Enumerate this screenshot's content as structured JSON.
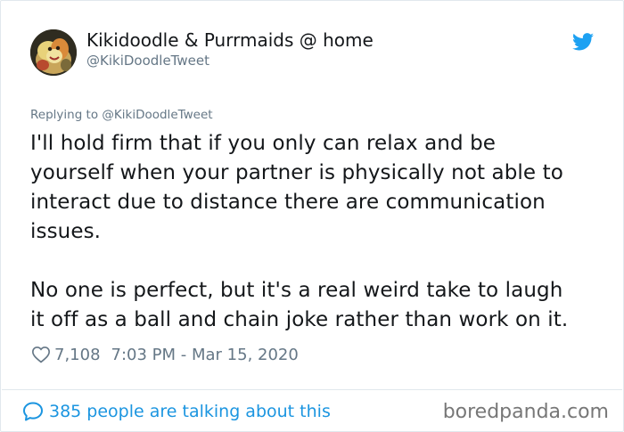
{
  "author": {
    "display_name": "Kikidoodle & Purrmaids @ home",
    "handle": "@KikiDoodleTweet",
    "avatar_icon": "avatar-illustration"
  },
  "reply": {
    "prefix": "Replying to ",
    "handle": "@KikiDoodleTweet"
  },
  "tweet": {
    "paragraphs": [
      "I'll hold firm that if you only can relax and be\nyourself when your partner is physically not able to\ninteract due to distance there are communication\nissues.",
      "No one is perfect, but it's a real weird take to laugh\nit off as a ball and chain joke rather than work on it."
    ]
  },
  "meta": {
    "likes": "7,108",
    "timestamp": "7:03 PM - Mar 15, 2020",
    "heart_icon": "heart-outline-icon"
  },
  "footer": {
    "conversation_text": "385 people are talking about this",
    "bubble_icon": "speech-bubble-icon"
  },
  "watermark": "boredpanda.com",
  "colors": {
    "link_blue": "#1b95e0",
    "twitter_blue": "#1da1f2",
    "secondary_text": "#657786",
    "primary_text": "#14171a",
    "border": "#e1e8ed"
  }
}
